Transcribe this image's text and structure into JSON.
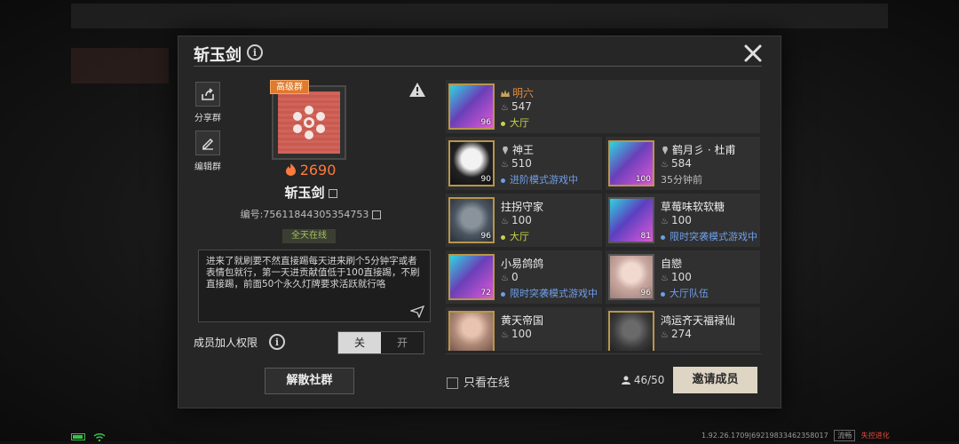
{
  "dialog": {
    "title": "斩玉剑"
  },
  "actions": {
    "share_label": "分享群",
    "edit_label": "编辑群"
  },
  "group": {
    "tier_tag": "高级群",
    "heat": "2690",
    "name": "斩玉剑",
    "id_text": "编号:75611844305354753",
    "online_tag": "全天在线",
    "description": "进来了就刷要不然直接踢每天进来刷个5分钟字或者表情包就行，第一天进贡献值低于100直接踢，不刷直接踢，前面50个永久灯牌要求活跃就行咯",
    "accent_color": "#e07a2c"
  },
  "permission": {
    "label": "成员加人权限",
    "off_label": "关",
    "on_label": "开",
    "selected": "关"
  },
  "dissolve_label": "解散社群",
  "members": [
    {
      "name": "明六",
      "heat": "547",
      "status": "大厅",
      "status_color": "#c8d24a",
      "level": "96",
      "role": "leader-crown-icon",
      "avatar_color": "#6a3fb8"
    },
    {
      "name": "神王",
      "heat": "510",
      "status": "进阶模式游戏中",
      "status_color": "#6f9ee8",
      "level": "90",
      "role": "member-rank-icon",
      "avatar_color": "#dcdcdc"
    },
    {
      "name": "鹤月彡 · 杜甫",
      "heat": "584",
      "status": "35分钟前",
      "status_color": "#bdbdbd",
      "level": "100",
      "role": "member-rank-icon",
      "avatar_color": "#6a3fb8"
    },
    {
      "name": "拄拐守家",
      "heat": "100",
      "status": "大厅",
      "status_color": "#c8d24a",
      "level": "96",
      "role": "",
      "avatar_color": "#4a5561"
    },
    {
      "name": "草莓味软软糖",
      "heat": "100",
      "status": "限时突袭模式游戏中",
      "status_color": "#6f9ee8",
      "level": "81",
      "role": "",
      "avatar_color": "#5b3fc0"
    },
    {
      "name": "小易鸽鸽",
      "heat": "0",
      "status": "限时突袭模式游戏中",
      "status_color": "#6f9ee8",
      "level": "72",
      "role": "",
      "avatar_color": "#6a3fb8"
    },
    {
      "name": "自戀",
      "heat": "100",
      "status": "大厅队伍",
      "status_color": "#6f9ee8",
      "level": "96",
      "role": "",
      "avatar_color": "#c9a8a0"
    },
    {
      "name": "黄天帝国",
      "heat": "100",
      "status": "",
      "status_color": "#bdbdbd",
      "level": "",
      "role": "",
      "avatar_color": "#b08a78"
    },
    {
      "name": "鸿运齐天福禄仙",
      "heat": "274",
      "status": "",
      "status_color": "#bdbdbd",
      "level": "",
      "role": "",
      "avatar_color": "#3a3a3a"
    }
  ],
  "footer": {
    "only_online_label": "只看在线",
    "member_count": "46/50",
    "invite_label": "邀请成员"
  },
  "statusbar": {
    "version": "1.92.26.1709|69219833462358017",
    "fluency": "流畅",
    "brand": "失控进化"
  }
}
